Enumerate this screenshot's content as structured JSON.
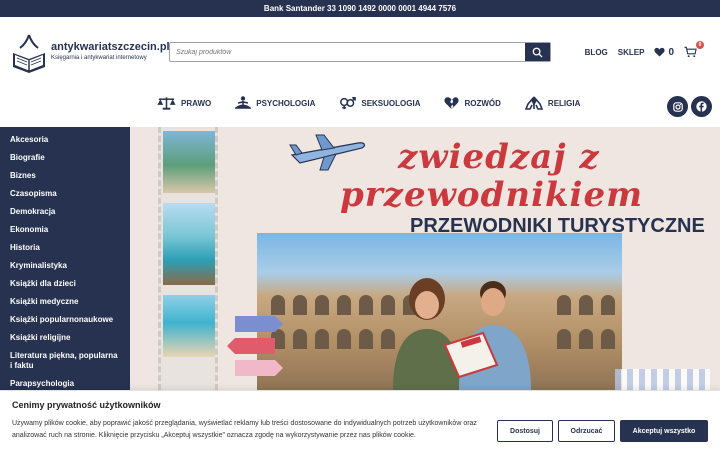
{
  "topbar": {
    "bank_text": "Bank Santander 33 1090 1492 0000 0001 4944 7576"
  },
  "header": {
    "logo_title": "antykwariatszczecin.pl",
    "logo_subtitle": "Księgarnia i antykwariat internetowy",
    "search_placeholder": "Szukaj produktów",
    "links": {
      "blog": "BLOG",
      "shop": "SKLEP"
    },
    "wishlist_count": "0",
    "cart_count": "0"
  },
  "nav": {
    "items": [
      {
        "label": "PRAWO",
        "icon": "scales-icon"
      },
      {
        "label": "PSYCHOLOGIA",
        "icon": "meditation-icon"
      },
      {
        "label": "SEKSUOLOGIA",
        "icon": "gender-icon"
      },
      {
        "label": "ROZWÓD",
        "icon": "broken-heart-icon"
      },
      {
        "label": "RELIGIA",
        "icon": "praying-icon"
      }
    ],
    "socials": [
      "instagram-icon",
      "facebook-icon"
    ]
  },
  "sidebar": {
    "items": [
      "Akcesoria",
      "Biografie",
      "Biznes",
      "Czasopisma",
      "Demokracja",
      "Ekonomia",
      "Historia",
      "Kryminalistyka",
      "Książki dla dzieci",
      "Książki medyczne",
      "Książki popularnonaukowe",
      "Książki religijne",
      "Literatura piękna, popularna i faktu",
      "Parapsychologia"
    ]
  },
  "banner": {
    "title_line1": "zwiedzaj z",
    "title_line2": "przewodnikiem",
    "subtitle": "PRZEWODNIKI TURYSTYCZNE"
  },
  "cookie": {
    "title": "Cenimy prywatność użytkowników",
    "text": "Używamy plików cookie, aby poprawić jakość przeglądania, wyświetlać reklamy lub treści dostosowane do indywidualnych potrzeb użytkowników oraz analizować ruch na stronie. Kliknięcie przycisku „Akceptuj wszystkie” oznacza zgodę na wykorzystywanie przez nas plików cookie.",
    "customize_label": "Dostosuj",
    "reject_label": "Odrzucać",
    "accept_label": "Akceptuj wszystko"
  },
  "colors": {
    "primary": "#26324f",
    "accent_red": "#c9393e",
    "banner_bg": "#efe6e1"
  }
}
